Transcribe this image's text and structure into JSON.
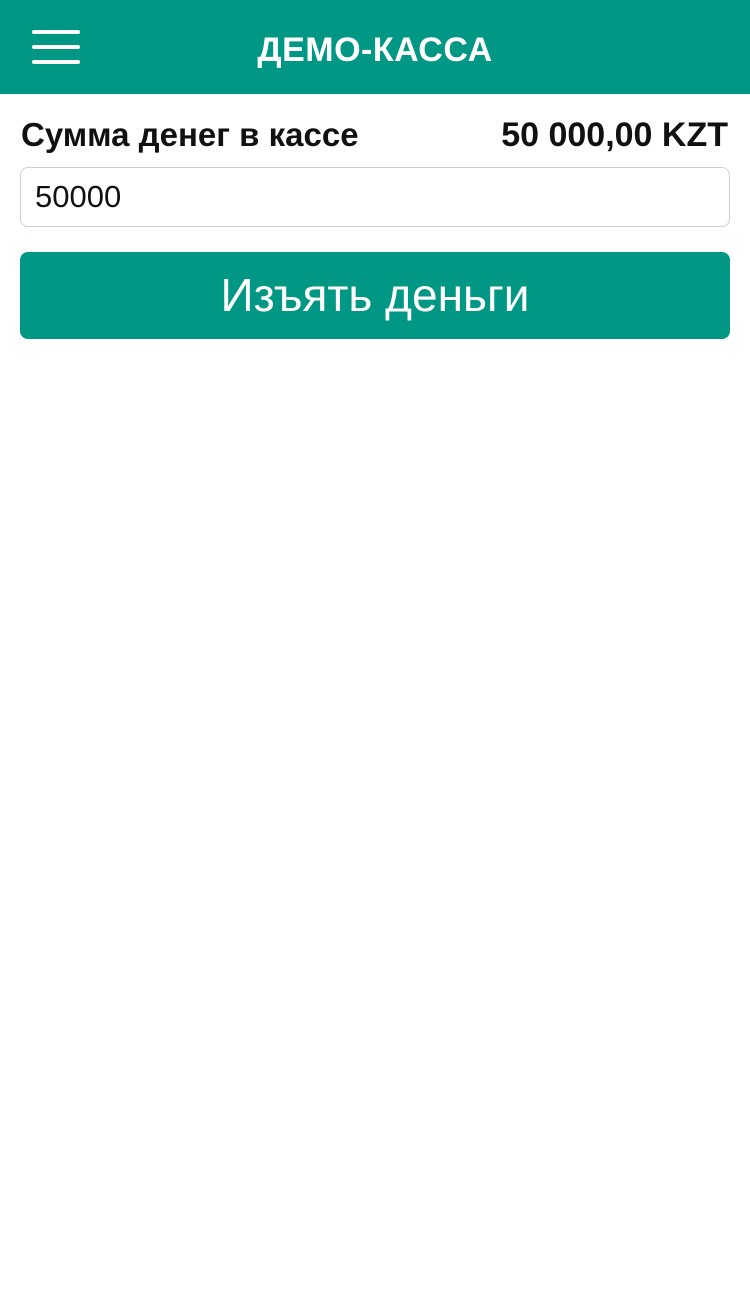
{
  "app_bar": {
    "title": "ДЕМО-КАССА",
    "menu_icon": "hamburger-menu-icon",
    "background_color": "#009784"
  },
  "cash": {
    "label": "Сумма денег в кассе",
    "amount": "50 000,00 KZT"
  },
  "amount_input": {
    "value": "50000"
  },
  "withdraw_button": {
    "label": "Изъять деньги",
    "color": "#009784"
  }
}
